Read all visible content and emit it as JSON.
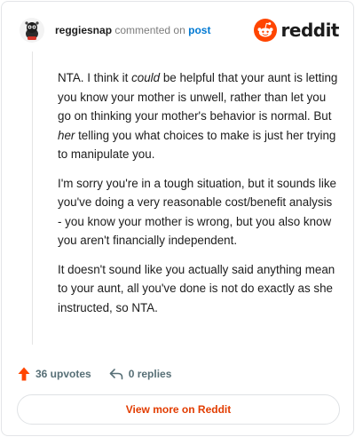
{
  "comment": {
    "username": "reggiesnap",
    "action_text": "commented on",
    "post_link_text": "post",
    "avatar_icon": "avatar-icon"
  },
  "brand": {
    "wordmark": "reddit",
    "logo_icon": "reddit-logo-icon",
    "accent_color": "#ff4500"
  },
  "body": {
    "p1_before": "NTA. I think it ",
    "p1_em": "could",
    "p1_after": " be helpful that your aunt is letting you know your mother is unwell, rather than let you go on thinking your mother's behavior is normal. But ",
    "p1_em2": "her",
    "p1_end": " telling you what choices to make is just her trying to manipulate you.",
    "p2": "I'm sorry you're in a tough situation, but it sounds like you've doing a very reasonable cost/benefit analysis - you know your mother is wrong, but you also know you aren't financially independent.",
    "p3": "It doesn't sound like you actually said anything mean to your aunt, all you've done is not do exactly as she instructed, so NTA."
  },
  "actions": {
    "upvotes_label": "36 upvotes",
    "replies_label": "0 replies",
    "upvote_icon": "upvote-arrow-icon",
    "reply_icon": "reply-arrow-icon"
  },
  "cta": {
    "label": "View more on Reddit",
    "color": "#e23c00"
  }
}
